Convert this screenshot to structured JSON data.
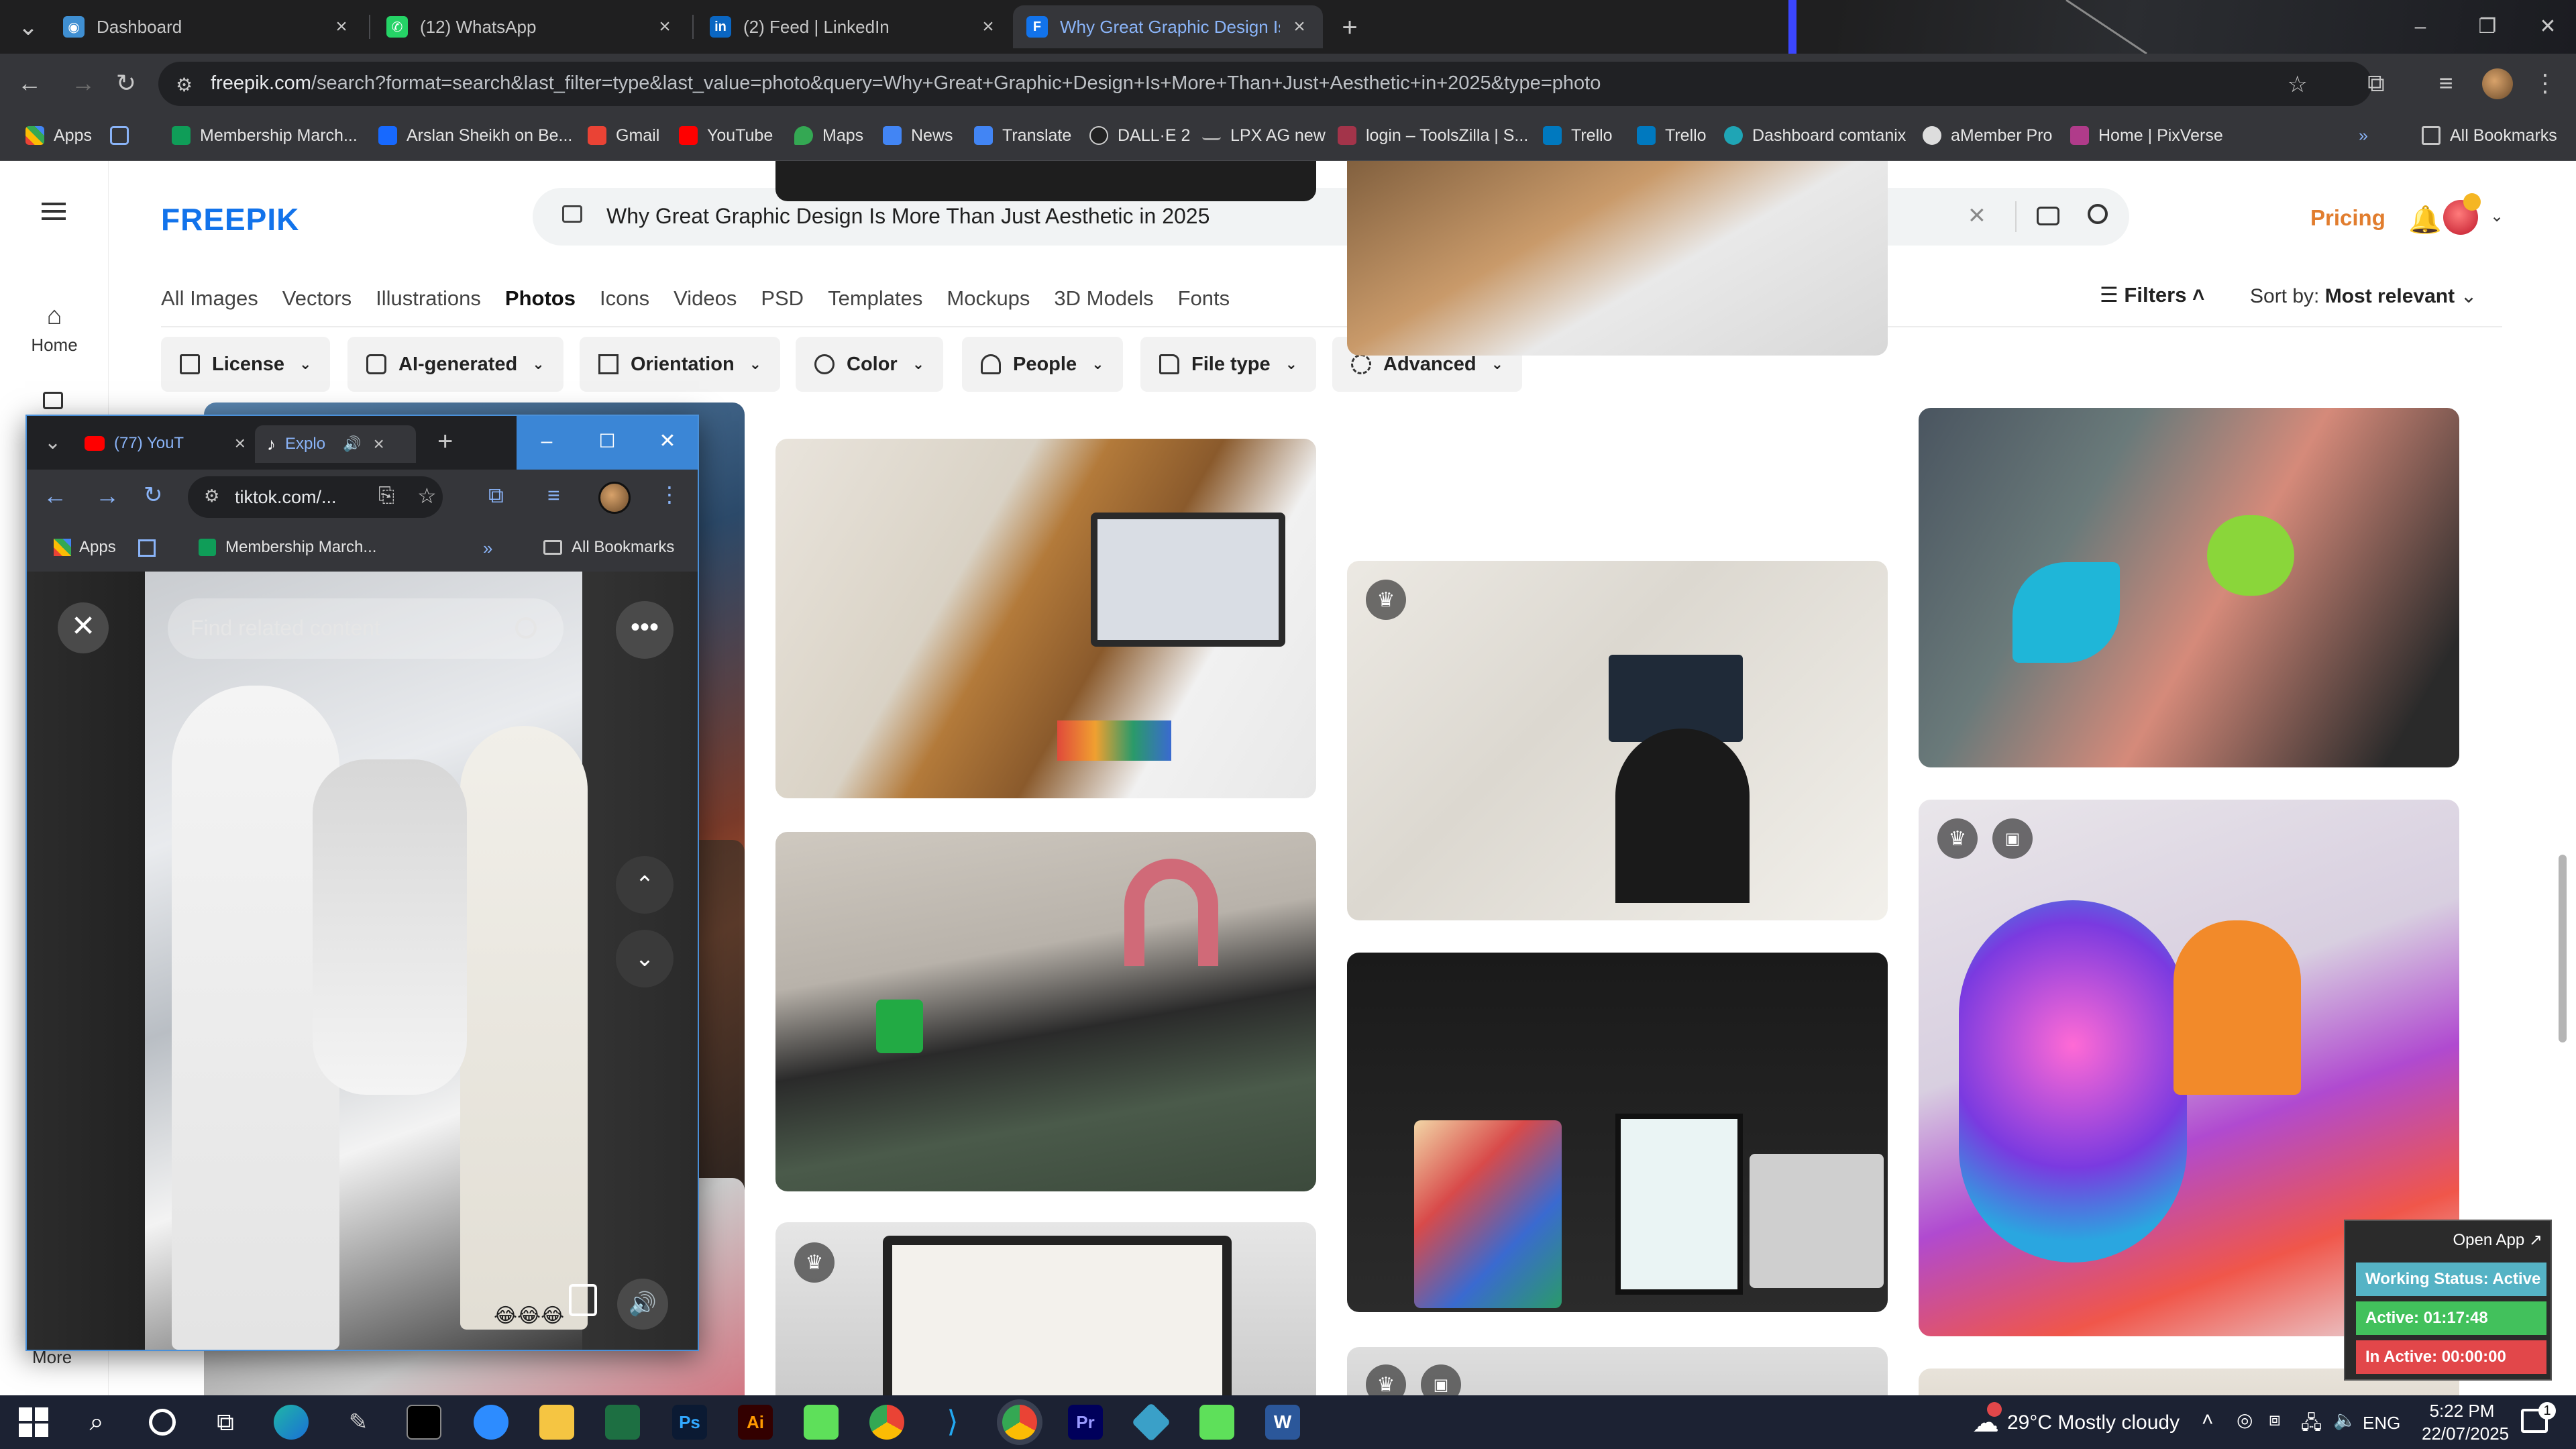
{
  "browser": {
    "tabs": [
      {
        "title": "Dashboard",
        "color": "#3f8fd2"
      },
      {
        "title": "(12) WhatsApp",
        "color": "#25d366"
      },
      {
        "title": "(2) Feed | LinkedIn",
        "color": "#0a66c2"
      },
      {
        "title": "Why Great Graphic Design Is M",
        "color": "#1273eb"
      }
    ],
    "url_domain": "freepik.com",
    "url_path": "/search?format=search&last_filter=type&last_value=photo&query=Why+Great+Graphic+Design+Is+More+Than+Just+Aesthetic+in+2025&type=photo",
    "bookmarks": [
      "Apps",
      "Membership March...",
      "Arslan Sheikh on Be...",
      "Gmail",
      "YouTube",
      "Maps",
      "News",
      "Translate",
      "DALL·E 2",
      "LPX AG new",
      "login – ToolsZilla | S...",
      "Trello",
      "Trello",
      "Dashboard comtanix",
      "aMember Pro",
      "Home | PixVerse"
    ],
    "all_bookmarks": "All Bookmarks",
    "more_bookmarks": "»"
  },
  "freepik": {
    "logo": "FREEPIK",
    "search_query": "Why Great Graphic Design Is More Than Just Aesthetic in 2025",
    "pricing": "Pricing",
    "left_nav": {
      "home": "Home",
      "more": "More"
    },
    "categories": [
      "All Images",
      "Vectors",
      "Illustrations",
      "Photos",
      "Icons",
      "Videos",
      "PSD",
      "Templates",
      "Mockups",
      "3D Models",
      "Fonts"
    ],
    "active_category": "Photos",
    "filters_label": "Filters",
    "sort_label": "Sort by:",
    "sort_value": "Most relevant",
    "filter_chips": [
      "License",
      "AI-generated",
      "Orientation",
      "Color",
      "People",
      "File type",
      "Advanced"
    ],
    "brand_color": "#1273eb",
    "pricing_color": "#e17d2e"
  },
  "popup": {
    "tabs": [
      {
        "title": "(77) YouT"
      },
      {
        "title": "Explo"
      }
    ],
    "url": "tiktok.com/...",
    "bookmarks": [
      "Apps",
      "Membership March..."
    ],
    "all_bookmarks": "All Bookmarks",
    "find_placeholder": "Find related content",
    "emoji_caption": "😂😂😂"
  },
  "status_widget": {
    "open_app": "Open App ↗",
    "working_status": "Working Status: Active",
    "active": "Active: 01:17:48",
    "inactive": "In Active: 00:00:00"
  },
  "taskbar": {
    "weather": "29°C  Mostly cloudy",
    "language": "ENG",
    "time": "5:22 PM",
    "date": "22/07/2025",
    "notification_count": "1"
  }
}
